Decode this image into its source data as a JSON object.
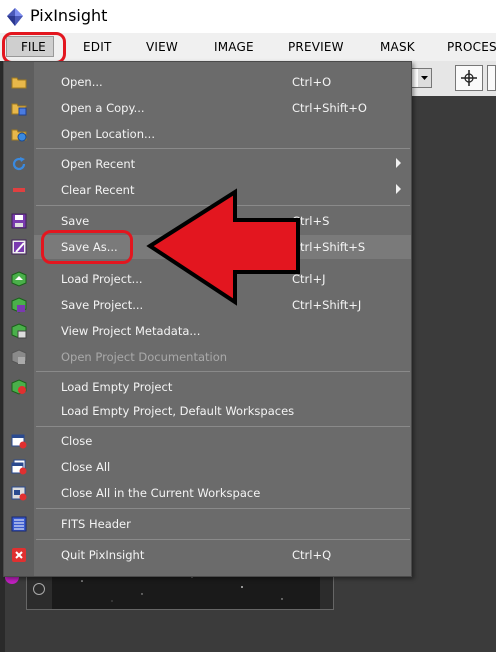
{
  "app": {
    "title": "PixInsight"
  },
  "menubar": {
    "items": [
      "FILE",
      "EDIT",
      "VIEW",
      "IMAGE",
      "PREVIEW",
      "MASK",
      "PROCES"
    ]
  },
  "file_menu": {
    "items": [
      {
        "label": "Open...",
        "shortcut": "Ctrl+O",
        "icon": "folder-open-icon"
      },
      {
        "label": "Open a Copy...",
        "shortcut": "Ctrl+Shift+O",
        "icon": "folder-copy-icon"
      },
      {
        "label": "Open Location...",
        "shortcut": "",
        "icon": "folder-globe-icon"
      },
      {
        "label": "Open Recent",
        "shortcut": "",
        "icon": "refresh-icon",
        "submenu": true
      },
      {
        "label": "Clear Recent",
        "shortcut": "",
        "icon": "minus-icon",
        "submenu": true
      },
      {
        "label": "Save",
        "shortcut": "Ctrl+S",
        "icon": "save-icon"
      },
      {
        "label": "Save As...",
        "shortcut": "Ctrl+Shift+S",
        "icon": "save-as-icon"
      },
      {
        "label": "Load Project...",
        "shortcut": "Ctrl+J",
        "icon": "load-project-icon"
      },
      {
        "label": "Save Project...",
        "shortcut": "Ctrl+Shift+J",
        "icon": "save-project-icon"
      },
      {
        "label": "View Project Metadata...",
        "shortcut": "",
        "icon": "project-metadata-icon"
      },
      {
        "label": "Open Project Documentation",
        "shortcut": "",
        "icon": "project-docs-icon",
        "disabled": true
      },
      {
        "label": "Load Empty Project",
        "shortcut": "",
        "icon": "empty-project-icon"
      },
      {
        "label": "Load Empty Project, Default Workspaces",
        "shortcut": "",
        "icon": ""
      },
      {
        "label": "Close",
        "shortcut": "",
        "icon": "close-window-icon"
      },
      {
        "label": "Close All",
        "shortcut": "",
        "icon": "close-all-icon"
      },
      {
        "label": "Close All in the Current Workspace",
        "shortcut": "",
        "icon": "close-workspace-icon"
      },
      {
        "label": "FITS Header",
        "shortcut": "",
        "icon": "fits-header-icon"
      },
      {
        "label": "Quit PixInsight",
        "shortcut": "Ctrl+Q",
        "icon": "quit-icon"
      }
    ]
  },
  "colors": {
    "annotation_red": "#e3161f",
    "menu_bg": "#6b6b6b",
    "menu_text": "#f4f4f4"
  }
}
